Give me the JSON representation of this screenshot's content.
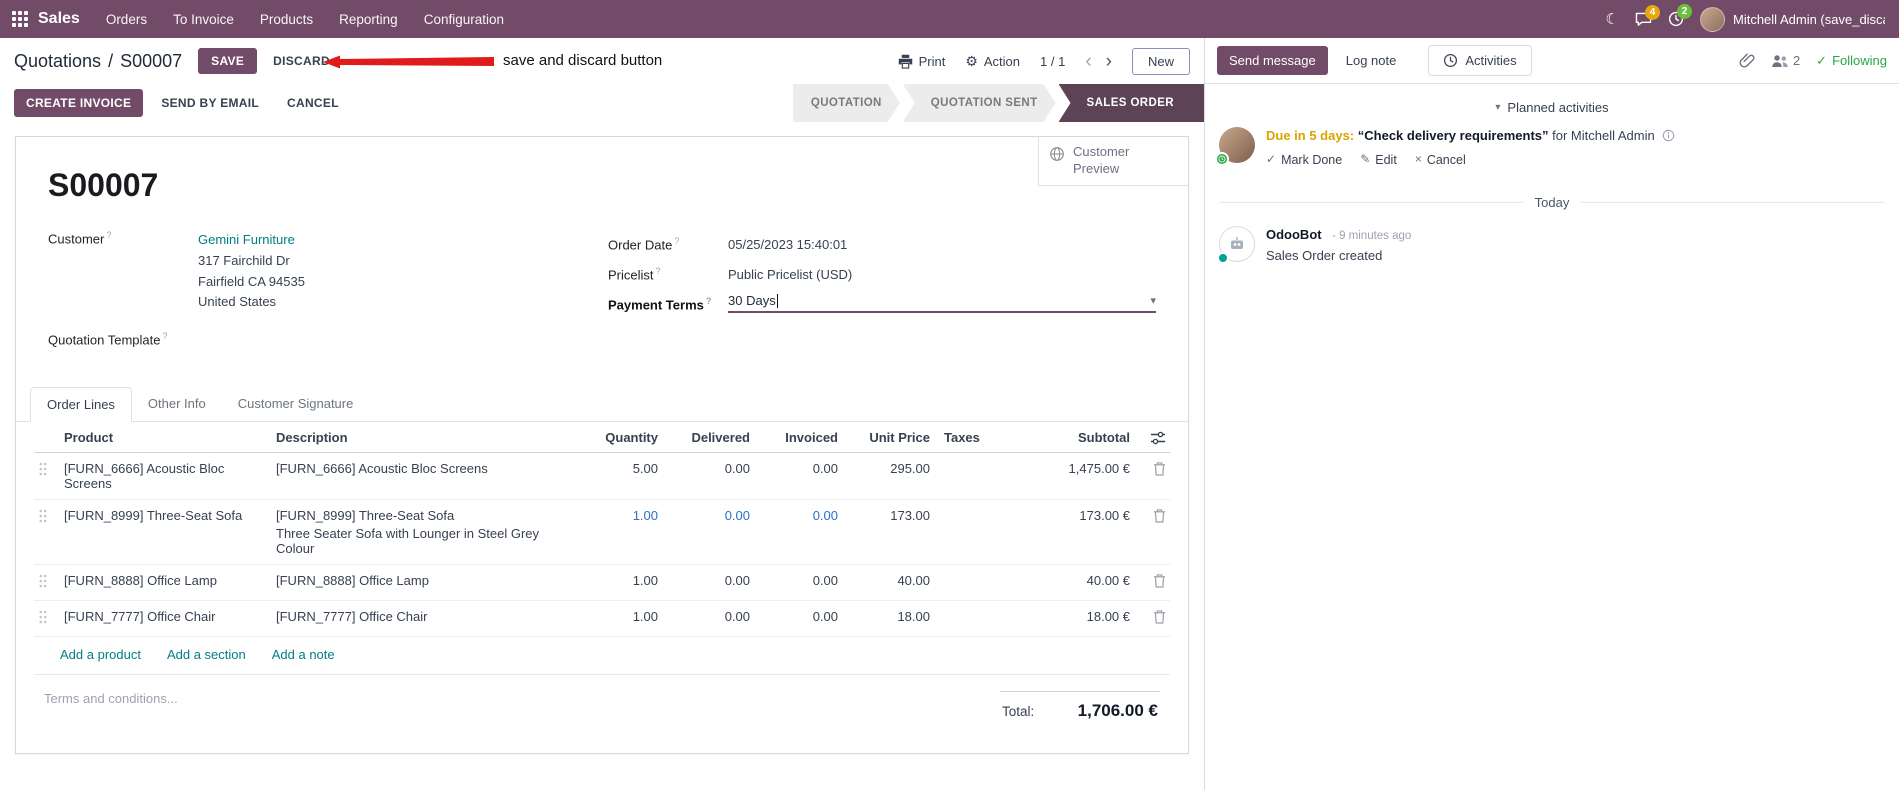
{
  "topbar": {
    "brand": "Sales",
    "menus": [
      "Orders",
      "To Invoice",
      "Products",
      "Reporting",
      "Configuration"
    ],
    "messages_badge": "4",
    "activities_badge": "2",
    "user_name": "Mitchell Admin (save_discar"
  },
  "icons": {
    "moon": "☾",
    "gear": "⚙",
    "caret_down": "▾",
    "chevron_left": "‹",
    "chevron_right": "›",
    "help": "?",
    "check": "✓",
    "pencil": "✎",
    "cross": "×",
    "slash": "/"
  },
  "control_bar": {
    "breadcrumb_parent": "Quotations",
    "breadcrumb_current": "S00007",
    "save_label": "SAVE",
    "discard_label": "DISCARD",
    "annotation_text": "save and discard button",
    "print_label": "Print",
    "action_label": "Action",
    "pager": "1 / 1",
    "new_label": "New"
  },
  "status_bar": {
    "create_invoice_label": "CREATE INVOICE",
    "send_by_email_label": "SEND BY EMAIL",
    "cancel_label": "CANCEL",
    "stages": [
      "QUOTATION",
      "QUOTATION SENT",
      "SALES ORDER"
    ],
    "active_stage": "SALES ORDER"
  },
  "form": {
    "customer_preview_label": "Customer Preview",
    "title": "S00007",
    "customer_label": "Customer",
    "customer_name": "Gemini Furniture",
    "address_line1": "317 Fairchild Dr",
    "address_line2": "Fairfield CA 94535",
    "address_line3": "United States",
    "quotation_template_label": "Quotation Template",
    "order_date_label": "Order Date",
    "order_date_value": "05/25/2023 15:40:01",
    "pricelist_label": "Pricelist",
    "pricelist_value": "Public Pricelist (USD)",
    "payment_terms_label": "Payment Terms",
    "payment_terms_value": "30 Days"
  },
  "tabs": {
    "order_lines": "Order Lines",
    "other_info": "Other Info",
    "customer_signature": "Customer Signature"
  },
  "order_lines": {
    "headers": {
      "product": "Product",
      "description": "Description",
      "quantity": "Quantity",
      "delivered": "Delivered",
      "invoiced": "Invoiced",
      "unit_price": "Unit Price",
      "taxes": "Taxes",
      "subtotal": "Subtotal"
    },
    "rows": [
      {
        "product": "[FURN_6666] Acoustic Bloc Screens",
        "description": "[FURN_6666] Acoustic Bloc Screens",
        "description2": "",
        "quantity": "5.00",
        "delivered": "0.00",
        "invoiced": "0.00",
        "unit_price": "295.00",
        "subtotal": "1,475.00 €"
      },
      {
        "product": "[FURN_8999] Three-Seat Sofa",
        "description": "[FURN_8999] Three-Seat Sofa",
        "description2": "Three Seater Sofa with Lounger in Steel Grey Colour",
        "quantity": "1.00",
        "delivered": "0.00",
        "invoiced": "0.00",
        "unit_price": "173.00",
        "subtotal": "173.00 €"
      },
      {
        "product": "[FURN_8888] Office Lamp",
        "description": "[FURN_8888] Office Lamp",
        "description2": "",
        "quantity": "1.00",
        "delivered": "0.00",
        "invoiced": "0.00",
        "unit_price": "40.00",
        "subtotal": "40.00 €"
      },
      {
        "product": "[FURN_7777] Office Chair",
        "description": "[FURN_7777] Office Chair",
        "description2": "",
        "quantity": "1.00",
        "delivered": "0.00",
        "invoiced": "0.00",
        "unit_price": "18.00",
        "subtotal": "18.00 €"
      }
    ],
    "add_product_label": "Add a product",
    "add_section_label": "Add a section",
    "add_note_label": "Add a note",
    "terms_placeholder": "Terms and conditions...",
    "total_label": "Total:",
    "total_value": "1,706.00 €"
  },
  "chatter": {
    "send_message_label": "Send message",
    "log_note_label": "Log note",
    "activities_label": "Activities",
    "followers_count": "2",
    "following_label": "Following",
    "planned_activities_label": "Planned activities",
    "activity": {
      "due_text": "Due in 5 days:",
      "summary": "“Check delivery requirements”",
      "assignee_text": "for Mitchell Admin",
      "mark_done_label": "Mark Done",
      "edit_label": "Edit",
      "cancel_label": "Cancel"
    },
    "date_divider": "Today",
    "message": {
      "author": "OdooBot",
      "timestamp": "- 9 minutes ago",
      "body": "Sales Order created"
    }
  },
  "colors": {
    "primary": "#714B67",
    "active_stage": "#5c4355",
    "link": "#017e84",
    "edited_value": "#2a6fd0",
    "warning": "#d9a300",
    "success": "#28a745",
    "annotation_arrow": "#e01b1b"
  }
}
